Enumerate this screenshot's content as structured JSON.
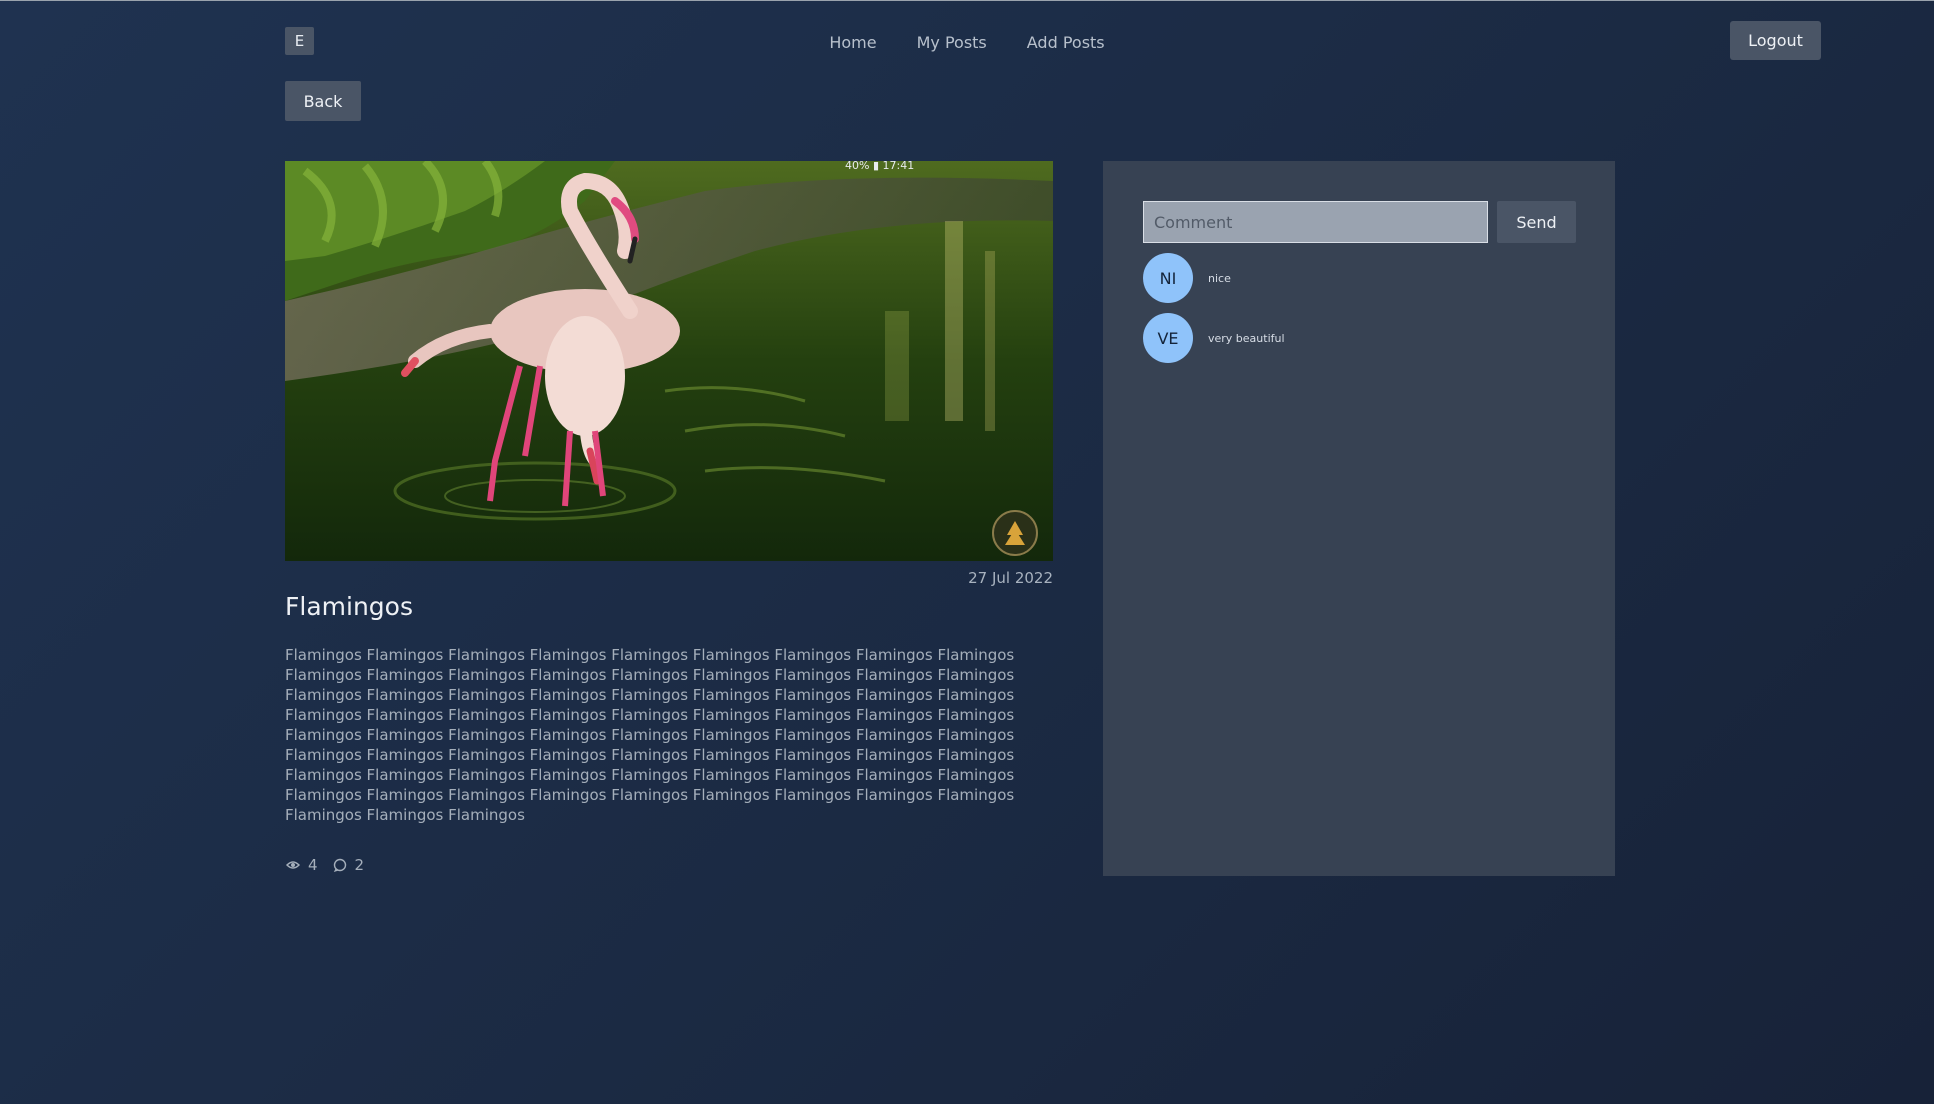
{
  "header": {
    "logo_letter": "E",
    "nav": [
      "Home",
      "My Posts",
      "Add Posts"
    ],
    "logout_label": "Logout"
  },
  "back_label": "Back",
  "post": {
    "image_alt": "Flamingos",
    "date": "27 Jul 2022",
    "title": "Flamingos",
    "body": "Flamingos Flamingos Flamingos Flamingos Flamingos Flamingos Flamingos Flamingos Flamingos Flamingos Flamingos Flamingos Flamingos Flamingos Flamingos Flamingos Flamingos Flamingos Flamingos Flamingos Flamingos Flamingos Flamingos Flamingos Flamingos Flamingos Flamingos Flamingos Flamingos Flamingos Flamingos Flamingos Flamingos Flamingos Flamingos Flamingos Flamingos Flamingos Flamingos Flamingos Flamingos Flamingos Flamingos Flamingos Flamingos Flamingos Flamingos Flamingos Flamingos Flamingos Flamingos Flamingos Flamingos Flamingos Flamingos Flamingos Flamingos Flamingos Flamingos Flamingos Flamingos Flamingos Flamingos Flamingos Flamingos Flamingos Flamingos Flamingos Flamingos Flamingos Flamingos Flamingos Flamingos Flamingos Flamingos",
    "views": "4",
    "comments_count": "2",
    "view_icon": "eye-icon",
    "comment_icon": "comment-bubble-icon"
  },
  "comments_panel": {
    "input_placeholder": "Comment",
    "input_value": "",
    "send_label": "Send",
    "comments": [
      {
        "initials": "NI",
        "text": "nice"
      },
      {
        "initials": "VE",
        "text": "very beautiful"
      }
    ]
  },
  "colors": {
    "background": "#1f3250",
    "button": "#4a5566",
    "panel": "#374253",
    "avatar": "#8fc3fa"
  }
}
